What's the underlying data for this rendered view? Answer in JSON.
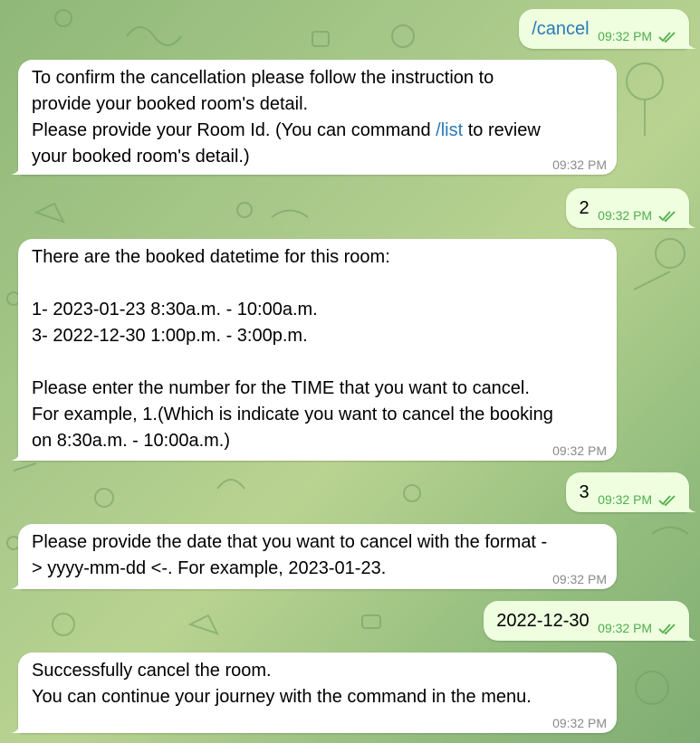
{
  "chat": {
    "m1": {
      "text": "/cancel",
      "time": "09:32 PM"
    },
    "m2": {
      "line1": "To confirm the cancellation please follow the instruction to",
      "line2": "provide your booked room's detail.",
      "line3_pre": "Please provide your Room Id. (You can command ",
      "line3_cmd": "/list",
      "line3_post": " to review",
      "line4": "your booked room's detail.)",
      "time": "09:32 PM"
    },
    "m3": {
      "text": "2",
      "time": "09:32 PM"
    },
    "m4": {
      "line1": "There are the booked datetime for this room:",
      "line2": "1- 2023-01-23 8:30a.m. - 10:00a.m.",
      "line3": "3- 2022-12-30 1:00p.m. - 3:00p.m.",
      "line4": "Please enter the number for the TIME that you want to cancel.",
      "line5": "For example, 1.(Which is indicate you want to cancel the booking",
      "line6": "on 8:30a.m. - 10:00a.m.)",
      "time": "09:32 PM"
    },
    "m5": {
      "text": "3",
      "time": "09:32 PM"
    },
    "m6": {
      "line1": "Please provide the date that you want to cancel with the format -",
      "line2": "> yyyy-mm-dd <-. For example, 2023-01-23.",
      "time": "09:32 PM"
    },
    "m7": {
      "text": "2022-12-30",
      "time": "09:32 PM"
    },
    "m8": {
      "line1": "Successfully cancel the room.",
      "line2": "You can continue your journey with the command in the menu.",
      "time": "09:32 PM"
    }
  },
  "colors": {
    "incoming_bubble": "#ffffff",
    "outgoing_bubble": "#eefedf",
    "link": "#2a7ab8",
    "outgoing_meta": "#4fae4e"
  },
  "icons": {
    "read_status": "double-check-icon"
  }
}
